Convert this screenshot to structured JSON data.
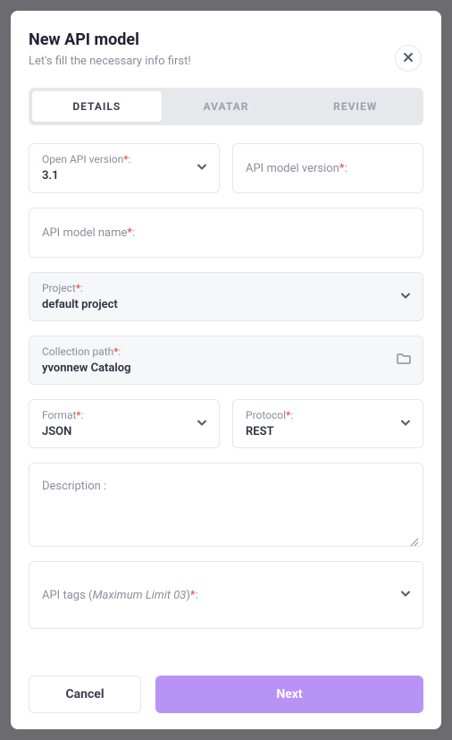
{
  "header": {
    "title": "New API model",
    "subtitle": "Let's fill the necessary info first!"
  },
  "tabs": {
    "details": "DETAILS",
    "avatar": "AVATAR",
    "review": "REVIEW"
  },
  "fields": {
    "open_api_version": {
      "label": "Open API version",
      "value": "3.1"
    },
    "model_version": {
      "label": "API model version"
    },
    "model_name": {
      "label": "API model name"
    },
    "project": {
      "label": "Project",
      "value": "default project"
    },
    "collection_path": {
      "label": "Collection path",
      "value": "yvonnew Catalog"
    },
    "format": {
      "label": "Format",
      "value": "JSON"
    },
    "protocol": {
      "label": "Protocol",
      "value": "REST"
    },
    "description": {
      "label": "Description :"
    },
    "tags": {
      "label_prefix": "API tags (",
      "label_em": "Maximum Limit 03",
      "label_suffix": ")"
    }
  },
  "footer": {
    "cancel": "Cancel",
    "next": "Next"
  }
}
